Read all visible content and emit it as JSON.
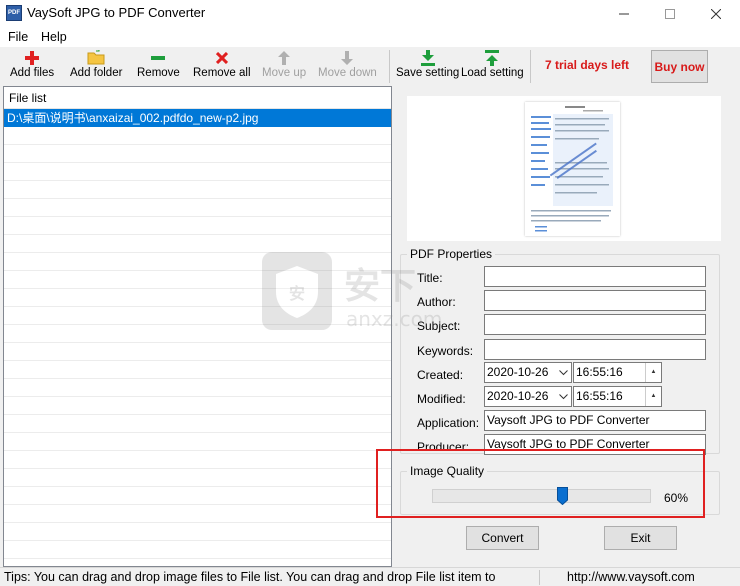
{
  "window": {
    "title": "VaySoft JPG to PDF Converter",
    "icon_label": "PDF"
  },
  "menu": [
    {
      "label": "File"
    },
    {
      "label": "Help"
    }
  ],
  "toolbar": {
    "add_files": "Add files",
    "add_folder": "Add folder",
    "remove": "Remove",
    "remove_all": "Remove all",
    "move_up": "Move up",
    "move_down": "Move down",
    "save_setting": "Save setting",
    "load_setting": "Load setting",
    "trial_text": "7 trial days left",
    "buy_now": "Buy now"
  },
  "file_list": {
    "header": "File list",
    "items": [
      "D:\\桌面\\说明书\\anxaizai_002.pdfdo_new-p2.jpg"
    ]
  },
  "pdf_properties": {
    "group_title": "PDF Properties",
    "title_label": "Title:",
    "title_value": "",
    "author_label": "Author:",
    "author_value": "",
    "subject_label": "Subject:",
    "subject_value": "",
    "keywords_label": "Keywords:",
    "keywords_value": "",
    "created_label": "Created:",
    "created_date": "2020-10-26",
    "created_time": "16:55:16",
    "modified_label": "Modified:",
    "modified_date": "2020-10-26",
    "modified_time": "16:55:16",
    "application_label": "Application:",
    "application_value": "Vaysoft JPG to PDF Converter",
    "producer_label": "Producer:",
    "producer_value": "Vaysoft JPG to PDF Converter"
  },
  "image_quality": {
    "group_title": "Image Quality",
    "value": 60,
    "value_text": "60%"
  },
  "buttons": {
    "convert": "Convert",
    "exit": "Exit"
  },
  "status": {
    "tips": "Tips: You can drag and drop image files to File list. You can drag and drop File list item to",
    "website": "http://www.vaysoft.com"
  },
  "watermark_text": "anxz.com",
  "colors": {
    "accent_red": "#d81a1a",
    "selection": "#0078d7",
    "highlight_box": "#e02020"
  }
}
